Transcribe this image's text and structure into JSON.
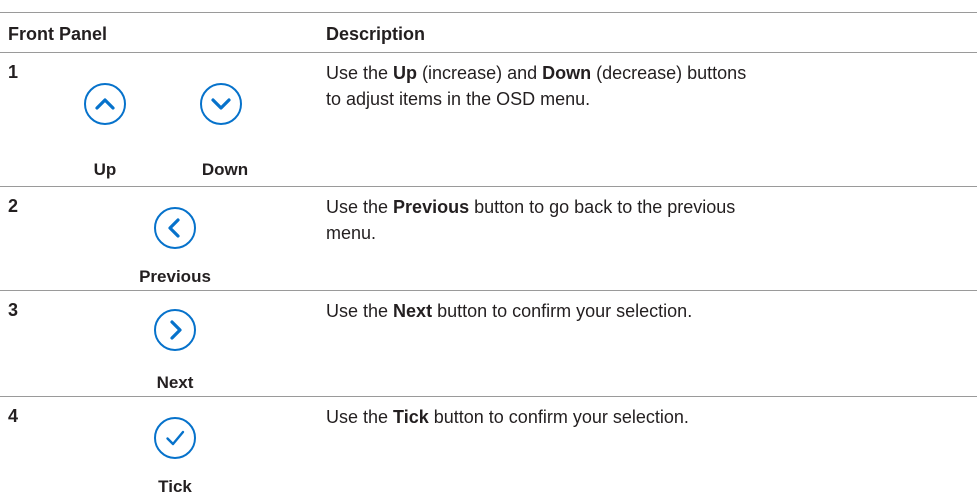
{
  "header": {
    "col_front_panel": "Front Panel",
    "col_description": "Description"
  },
  "rows": [
    {
      "number": "1",
      "buttons": [
        {
          "icon": "chevron-up-icon",
          "label": "Up"
        },
        {
          "icon": "chevron-down-icon",
          "label": "Down"
        }
      ],
      "description": {
        "p1": "Use the ",
        "b1": "Up",
        "p2": " (increase) and ",
        "b2": "Down",
        "p3": " (decrease) buttons to adjust items in the OSD menu."
      }
    },
    {
      "number": "2",
      "buttons": [
        {
          "icon": "chevron-left-icon",
          "label": "Previous"
        }
      ],
      "description": {
        "p1": "Use the ",
        "b1": "Previous",
        "p2": " button to go back to the previous menu."
      }
    },
    {
      "number": "3",
      "buttons": [
        {
          "icon": "chevron-right-icon",
          "label": "Next"
        }
      ],
      "description": {
        "p1": "Use the ",
        "b1": "Next",
        "p2": " button to confirm your selection."
      }
    },
    {
      "number": "4",
      "buttons": [
        {
          "icon": "checkmark-icon",
          "label": "Tick"
        }
      ],
      "description": {
        "p1": "Use the ",
        "b1": "Tick",
        "p2": " button to confirm your selection."
      }
    }
  ],
  "colors": {
    "icon_blue": "#0672cb",
    "rule": "#9a9a9a",
    "text": "#231f20"
  }
}
